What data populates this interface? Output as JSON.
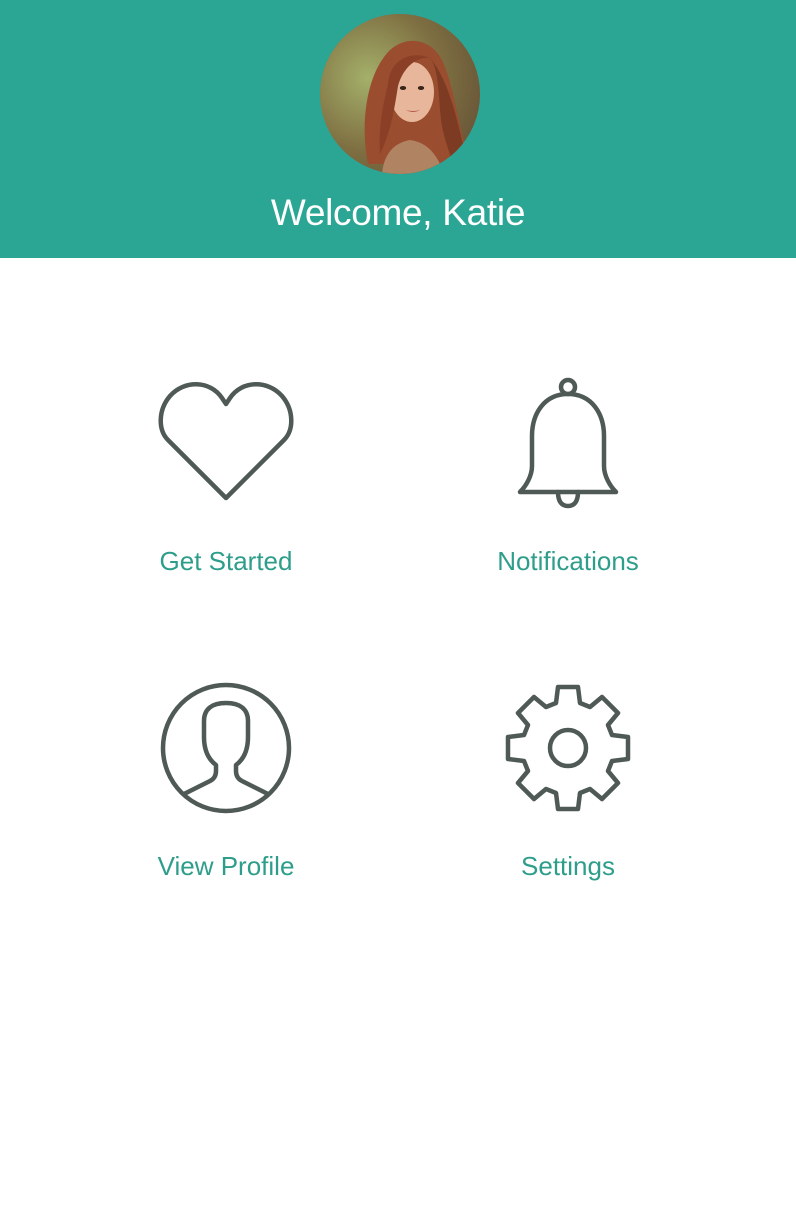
{
  "header": {
    "welcome_text": "Welcome, Katie",
    "background_color": "#2ba695",
    "avatar_icon": "profile-photo"
  },
  "menu": {
    "text_color": "#2e9e8b",
    "icon_color": "#4f5956",
    "items": [
      {
        "label": "Get Started",
        "icon": "heart-icon"
      },
      {
        "label": "Notifications",
        "icon": "bell-icon"
      },
      {
        "label": "View Profile",
        "icon": "user-profile-icon"
      },
      {
        "label": "Settings",
        "icon": "gear-icon"
      }
    ]
  }
}
